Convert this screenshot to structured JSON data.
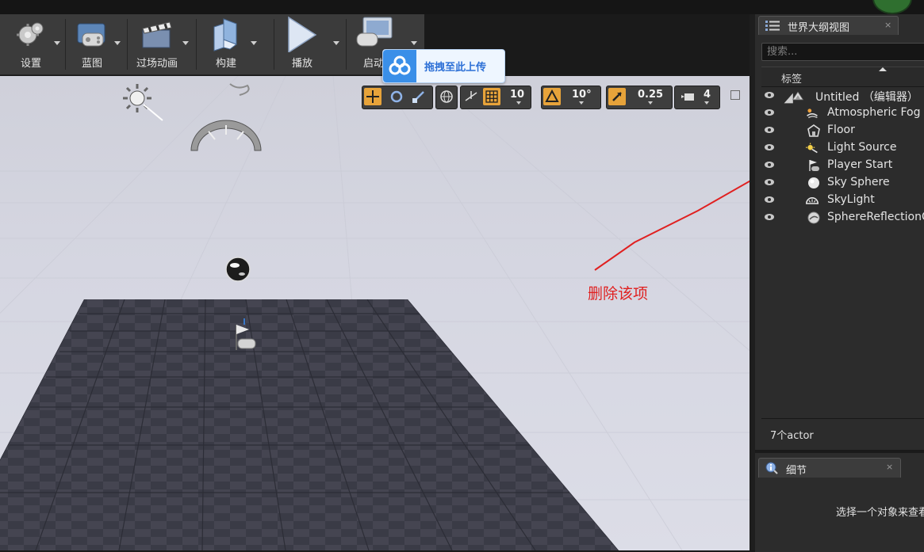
{
  "toolbar": {
    "buttons": [
      {
        "label": "设置",
        "icon": "settings-gears-icon"
      },
      {
        "label": "蓝图",
        "icon": "blueprint-icon"
      },
      {
        "label": "过场动画",
        "icon": "cinematics-clapper-icon"
      },
      {
        "label": "构建",
        "icon": "build-blocks-icon"
      },
      {
        "label": "播放",
        "icon": "play-triangle-icon"
      },
      {
        "label": "启动",
        "icon": "launch-gamepad-icon"
      }
    ]
  },
  "upload_tooltip": {
    "text": "拖拽至此上传",
    "icon": "baidu-cloud-icon"
  },
  "viewport": {
    "toolbar": {
      "grid_snap": "10",
      "rotation_snap": "10°",
      "scale_snap": "0.25",
      "camera_speed": "4"
    },
    "annotation": "删除该项",
    "annotation_color": "#e02020"
  },
  "outliner": {
    "tab_title": "世界大纲视图",
    "search_placeholder": "搜索...",
    "column_header": "标签",
    "items": [
      {
        "name": "Untitled （编辑器）",
        "icon": "world-icon"
      },
      {
        "name": "Atmospheric Fog",
        "icon": "atmospheric-fog-icon"
      },
      {
        "name": "Floor",
        "icon": "static-mesh-icon"
      },
      {
        "name": "Light Source",
        "icon": "directional-light-icon"
      },
      {
        "name": "Player Start",
        "icon": "player-start-icon"
      },
      {
        "name": "Sky Sphere",
        "icon": "sphere-icon"
      },
      {
        "name": "SkyLight",
        "icon": "sky-light-icon"
      },
      {
        "name": "SphereReflectionCapture",
        "icon": "reflection-capture-icon"
      }
    ],
    "footer": "7个actor"
  },
  "details": {
    "tab_title": "细节",
    "hint": "选择一个对象来查看细节。"
  },
  "close_glyph": "×"
}
